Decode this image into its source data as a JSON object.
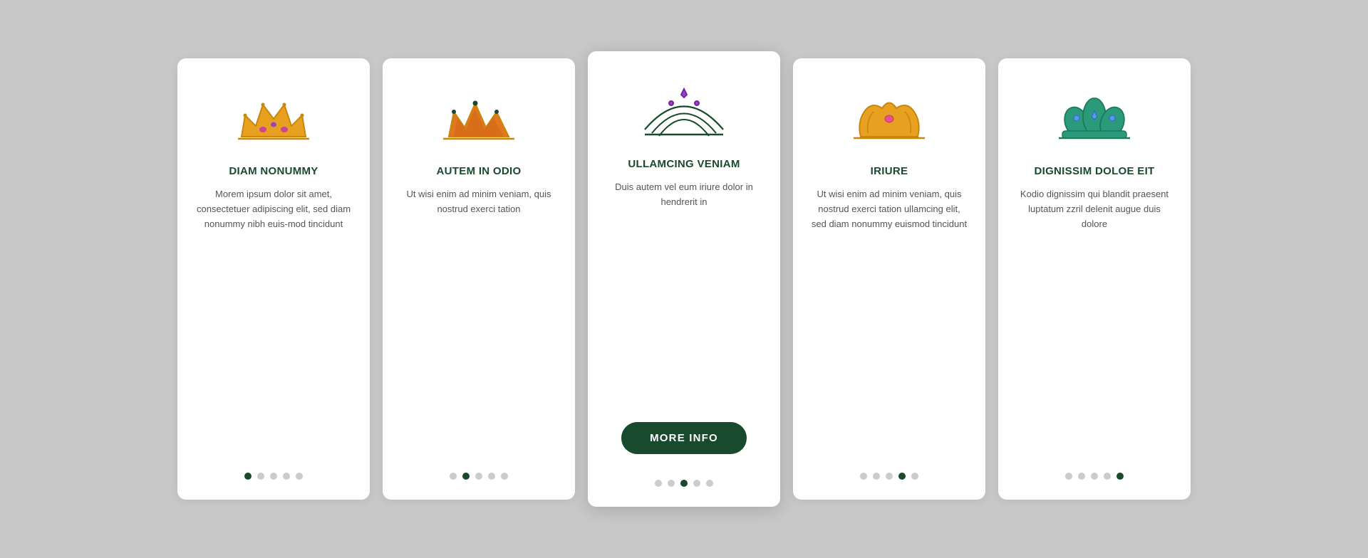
{
  "cards": [
    {
      "id": "card-1",
      "title": "DIAM NONUMMY",
      "text": "Morem ipsum dolor sit amet, consectetuer adipiscing elit, sed diam nonummy nibh euis-mod tincidunt",
      "active_dot": 0,
      "has_button": false,
      "is_active": false,
      "icon": "crown-gold-gems"
    },
    {
      "id": "card-2",
      "title": "AUTEM IN ODIO",
      "text": "Ut wisi enim ad minim veniam, quis nostrud exerci tation",
      "active_dot": 1,
      "has_button": false,
      "is_active": false,
      "icon": "crown-orange"
    },
    {
      "id": "card-3",
      "title": "ULLAMCING VENIAM",
      "text": "Duis autem vel eum iriure dolor in hendrerit in",
      "active_dot": 2,
      "has_button": true,
      "is_active": true,
      "button_label": "MORE INFO",
      "icon": "tiara-purple"
    },
    {
      "id": "card-4",
      "title": "IRIURE",
      "text": "Ut wisi enim ad minim veniam, quis nostrud exerci tation ullamcing elit, sed diam nonummy euismod tincidunt",
      "active_dot": 3,
      "has_button": false,
      "is_active": false,
      "icon": "crown-gold-leaf"
    },
    {
      "id": "card-5",
      "title": "DIGNISSIM DOLOE EIT",
      "text": "Kodio dignissim qui blandit praesent luptatum zzril delenit augue duis dolore",
      "active_dot": 4,
      "has_button": false,
      "is_active": false,
      "icon": "crown-teal"
    }
  ],
  "dots_count": 5
}
